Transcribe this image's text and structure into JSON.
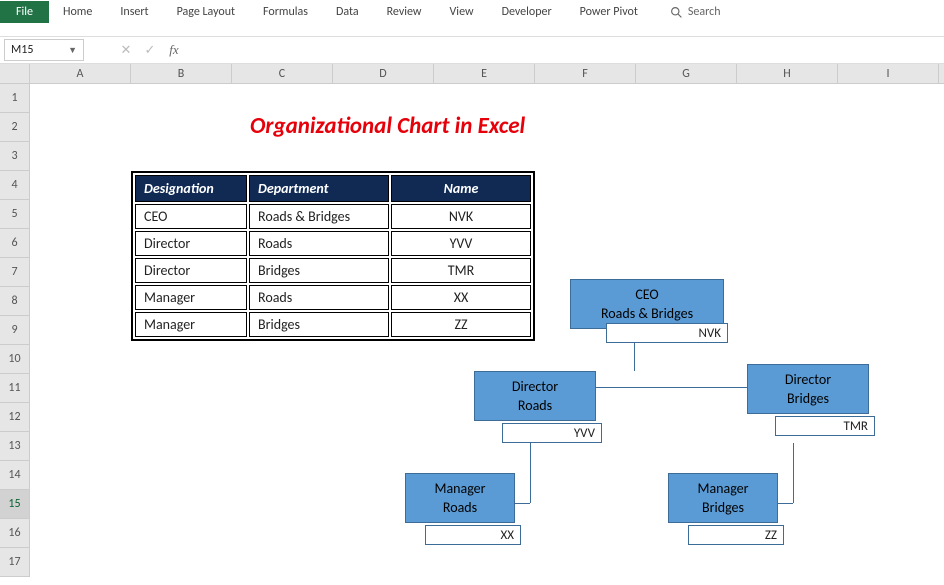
{
  "ribbon": {
    "tabs": [
      "File",
      "Home",
      "Insert",
      "Page Layout",
      "Formulas",
      "Data",
      "Review",
      "View",
      "Developer",
      "Power Pivot"
    ],
    "search": "Search"
  },
  "namebox": "M15",
  "columns": [
    "A",
    "B",
    "C",
    "D",
    "E",
    "F",
    "G",
    "H",
    "I"
  ],
  "rows": [
    "1",
    "2",
    "3",
    "4",
    "5",
    "6",
    "7",
    "8",
    "9",
    "10",
    "11",
    "12",
    "13",
    "14",
    "15",
    "16",
    "17"
  ],
  "selectedRow": "15",
  "title": "Organizational Chart in Excel",
  "table": {
    "headers": [
      "Designation",
      "Department",
      "Name"
    ],
    "rows": [
      [
        "CEO",
        "Roads & Bridges",
        "NVK"
      ],
      [
        "Director",
        "Roads",
        "YVV"
      ],
      [
        "Director",
        "Bridges",
        "TMR"
      ],
      [
        "Manager",
        "Roads",
        "XX"
      ],
      [
        "Manager",
        "Bridges",
        "ZZ"
      ]
    ]
  },
  "org": {
    "ceo": {
      "title": "CEO",
      "dept": "Roads & Bridges",
      "name": "NVK"
    },
    "dir1": {
      "title": "Director",
      "dept": "Roads",
      "name": "YVV"
    },
    "dir2": {
      "title": "Director",
      "dept": "Bridges",
      "name": "TMR"
    },
    "mgr1": {
      "title": "Manager",
      "dept": "Roads",
      "name": "XX"
    },
    "mgr2": {
      "title": "Manager",
      "dept": "Bridges",
      "name": "ZZ"
    }
  },
  "chart_data": {
    "type": "hierarchy",
    "title": "Organizational Chart in Excel",
    "root": {
      "designation": "CEO",
      "department": "Roads & Bridges",
      "name": "NVK",
      "children": [
        {
          "designation": "Director",
          "department": "Roads",
          "name": "YVV",
          "children": [
            {
              "designation": "Manager",
              "department": "Roads",
              "name": "XX"
            }
          ]
        },
        {
          "designation": "Director",
          "department": "Bridges",
          "name": "TMR",
          "children": [
            {
              "designation": "Manager",
              "department": "Bridges",
              "name": "ZZ"
            }
          ]
        }
      ]
    }
  }
}
